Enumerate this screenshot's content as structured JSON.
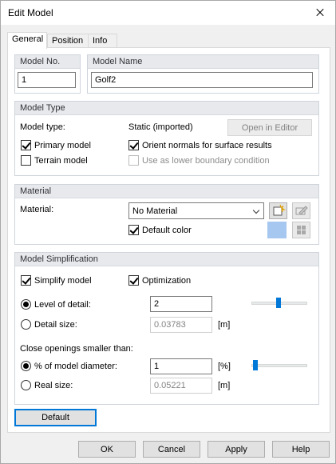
{
  "window": {
    "title": "Edit Model"
  },
  "tabs": [
    {
      "label": "General",
      "active": true
    },
    {
      "label": "Position",
      "active": false
    },
    {
      "label": "Info",
      "active": false
    }
  ],
  "model_no": {
    "header": "Model No.",
    "value": "1"
  },
  "model_name": {
    "header": "Model Name",
    "value": "Golf2"
  },
  "model_type": {
    "header": "Model Type",
    "type_label": "Model type:",
    "type_value": "Static (imported)",
    "open_editor": "Open in Editor",
    "primary_model": {
      "label": "Primary model",
      "checked": true
    },
    "terrain_model": {
      "label": "Terrain model",
      "checked": false
    },
    "orient_normals": {
      "label": "Orient normals for surface results",
      "checked": true
    },
    "lower_boundary": {
      "label": "Use as lower boundary condition",
      "checked": false,
      "enabled": false
    }
  },
  "material": {
    "header": "Material",
    "label": "Material:",
    "selected": "No Material",
    "default_color": {
      "label": "Default color",
      "checked": true
    },
    "swatch_color": "#a6c8f0"
  },
  "simplification": {
    "header": "Model Simplification",
    "simplify": {
      "label": "Simplify model",
      "checked": true
    },
    "optimization": {
      "label": "Optimization",
      "checked": true
    },
    "level_of_detail": {
      "label": "Level of detail:",
      "value": "2",
      "selected": true,
      "slider_fraction": 0.48
    },
    "detail_size": {
      "label": "Detail size:",
      "value": "0.03783",
      "unit": "[m]",
      "selected": false
    },
    "close_openings": "Close openings smaller than:",
    "pct_diameter": {
      "label": "% of model diameter:",
      "value": "1",
      "unit": "[%]",
      "selected": true,
      "slider_fraction": 0.03
    },
    "real_size": {
      "label": "Real size:",
      "value": "0.05221",
      "unit": "[m]",
      "selected": false
    }
  },
  "default_button": "Default",
  "footer": {
    "ok": "OK",
    "cancel": "Cancel",
    "apply": "Apply",
    "help": "Help"
  },
  "colors": {
    "accent": "#0078d7",
    "group_header": "#e7e9ec"
  }
}
